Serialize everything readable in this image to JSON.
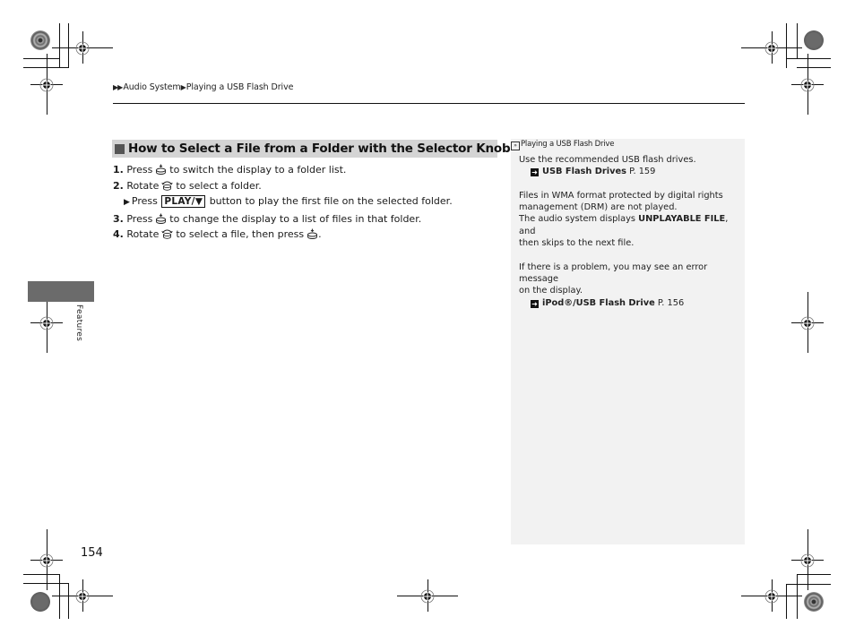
{
  "breadcrumb": {
    "prefix_icon": "double-triangle-right-icon",
    "items": [
      "Audio System",
      "Playing a USB Flash Drive"
    ],
    "separator_icon": "triangle-right-icon"
  },
  "section": {
    "heading_icon": "square-bullet-icon",
    "title": "How to Select a File from a Folder with the Selector Knob"
  },
  "steps": [
    {
      "num": "1.",
      "pre": "Press",
      "icon": "press-knob-icon",
      "post": "to switch the display to a folder list."
    },
    {
      "num": "2.",
      "pre": "Rotate",
      "icon": "rotate-knob-icon",
      "post": "to select a folder."
    },
    {
      "num": "3.",
      "pre": "Press",
      "icon": "press-knob-icon",
      "post": "to change the display to a list of files in that folder."
    },
    {
      "num": "4.",
      "pre": "Rotate",
      "icon": "rotate-knob-icon",
      "mid": "to select a file, then press",
      "icon2": "press-knob-icon",
      "post": "."
    }
  ],
  "substep": {
    "pre": "Press",
    "button_label": "PLAY/▼",
    "post": "button to play the first file on the selected folder."
  },
  "side_note": {
    "title_icon": "note-marker-icon",
    "title": "Playing a USB Flash Drive",
    "para1": "Use the recommended USB flash drives.",
    "ref1": {
      "icon": "cross-reference-icon",
      "label": "USB Flash Drives",
      "page": "P. 159"
    },
    "para2_line1": "Files in WMA format protected by digital rights",
    "para2_line2": "management (DRM) are not played.",
    "para2_line3_pre": "The audio system displays ",
    "para2_line3_bold": "UNPLAYABLE FILE",
    "para2_line3_post": ", and",
    "para2_line4": "then skips to the next file.",
    "para3_line1": "If there is a problem, you may see an error message",
    "para3_line2": "on the display.",
    "ref2": {
      "icon": "cross-reference-icon",
      "label": "iPod®/USB Flash Drive",
      "page": "P. 156"
    }
  },
  "page_number": "154",
  "chapter_tab": "Features",
  "colors": {
    "heading_bar": "#d4d4d4",
    "side_panel": "#f2f2f2",
    "chapter_tab": "#6b6b6b"
  }
}
